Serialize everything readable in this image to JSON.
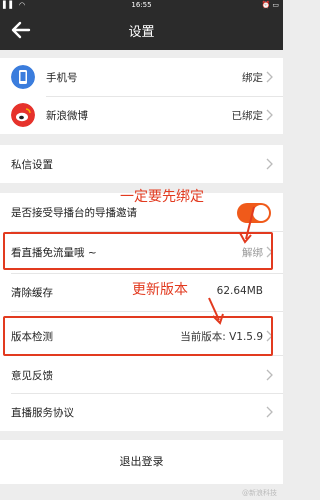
{
  "status_bar": {
    "time": "16:55",
    "left_icons": "▌▌ ◠",
    "right_icons": "⏰ ▭"
  },
  "nav": {
    "title": "设置"
  },
  "accounts": [
    {
      "label": "手机号",
      "value": "绑定",
      "icon": "phone-icon",
      "color": "#3b7ddd"
    },
    {
      "label": "新浪微博",
      "value": "已绑定",
      "icon": "weibo-icon",
      "color": "#e6322b"
    }
  ],
  "private_msg": {
    "label": "私信设置"
  },
  "settings": {
    "invite_label": "是否接受导播台的导播邀请",
    "invite_enabled": true,
    "free_flow_label": "看直播免流量哦 ~",
    "free_flow_value": "解绑",
    "clear_cache_label": "清除缓存",
    "clear_cache_value": "62.64MB",
    "version_label": "版本检测",
    "version_value": "当前版本: V1.5.9",
    "feedback_label": "意见反馈",
    "agreement_label": "直播服务协议"
  },
  "logout": {
    "label": "退出登录"
  },
  "annotations": {
    "bind_note": "一定要先绑定",
    "update_note": "更新版本"
  },
  "watermark": "@新浪科技",
  "colors": {
    "accent": "#f05a1a",
    "annotation": "#e23a1f",
    "bar": "#2b2b2b"
  }
}
